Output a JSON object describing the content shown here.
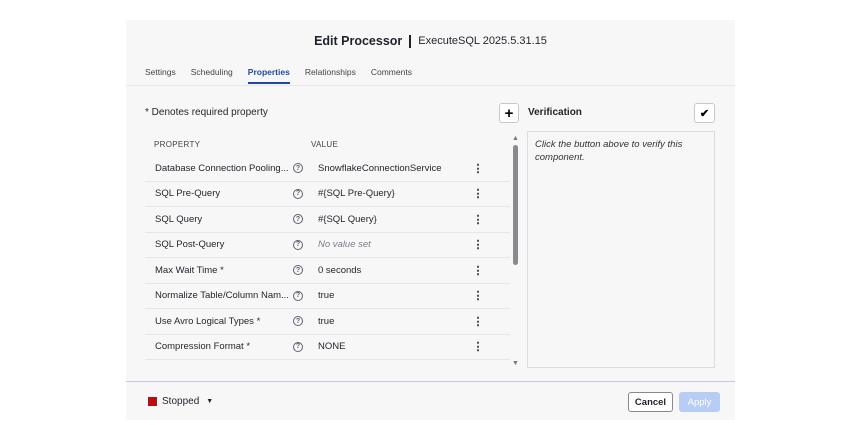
{
  "header": {
    "title": "Edit Processor",
    "subtitle": "ExecuteSQL 2025.5.31.15"
  },
  "tabs": [
    {
      "label": "Settings",
      "active": false
    },
    {
      "label": "Scheduling",
      "active": false
    },
    {
      "label": "Properties",
      "active": true
    },
    {
      "label": "Relationships",
      "active": false
    },
    {
      "label": "Comments",
      "active": false
    }
  ],
  "properties": {
    "required_note": "* Denotes required property",
    "add_icon": "plus-icon",
    "columns": {
      "property": "PROPERTY",
      "value": "VALUE"
    },
    "rows": [
      {
        "name": "Database Connection Pooling...",
        "value": "SnowflakeConnectionService",
        "empty": false
      },
      {
        "name": "SQL Pre-Query",
        "value": "#{SQL Pre-Query}",
        "empty": false
      },
      {
        "name": "SQL Query",
        "value": "#{SQL Query}",
        "empty": false
      },
      {
        "name": "SQL Post-Query",
        "value": "No value set",
        "empty": true
      },
      {
        "name": "Max Wait Time *",
        "value": "0 seconds",
        "empty": false
      },
      {
        "name": "Normalize Table/Column Nam...",
        "value": "true",
        "empty": false
      },
      {
        "name": "Use Avro Logical Types *",
        "value": "true",
        "empty": false
      },
      {
        "name": "Compression Format *",
        "value": "NONE",
        "empty": false
      }
    ]
  },
  "verification": {
    "title": "Verification",
    "button_icon": "checkmark-icon",
    "message": "Click the button above to verify this component."
  },
  "footer": {
    "status": "Stopped",
    "status_color": "#b80d15",
    "cancel_label": "Cancel",
    "apply_label": "Apply"
  }
}
